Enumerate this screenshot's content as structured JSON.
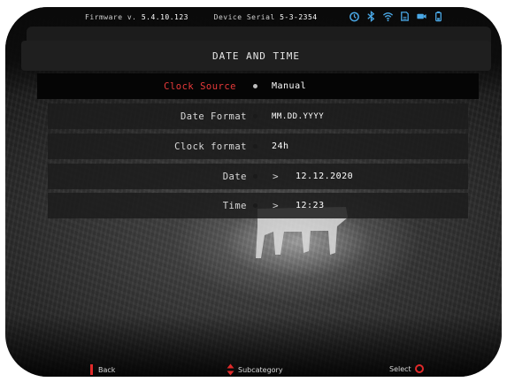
{
  "status_bar": {
    "firmware_label": "Firmware v.",
    "firmware_version": "5.4.10.123",
    "serial_label": "Device Serial",
    "serial_value": "5-3-2354",
    "icons": [
      "timer-icon",
      "bluetooth-icon",
      "wifi-icon",
      "sd-card-icon",
      "video-record-icon",
      "battery-icon"
    ],
    "icon_color": "#4aa8e6"
  },
  "title": "DATE AND TIME",
  "menu": {
    "items": [
      {
        "label": "Clock Source",
        "value": "Manual"
      },
      {
        "label": "Date Format",
        "value": "MM.DD.YYYY"
      },
      {
        "label": "Clock format",
        "value": "24h"
      },
      {
        "label": "Date",
        "value": "12.12.2020"
      },
      {
        "label": "Time",
        "value": "12:23"
      }
    ],
    "chevron": ">"
  },
  "footer": {
    "back_label": "Back",
    "subcategory_label": "Subcategory",
    "select_label": "Select"
  },
  "colors": {
    "accent_red": "#e83a3a",
    "status_blue": "#4aa8e6"
  }
}
